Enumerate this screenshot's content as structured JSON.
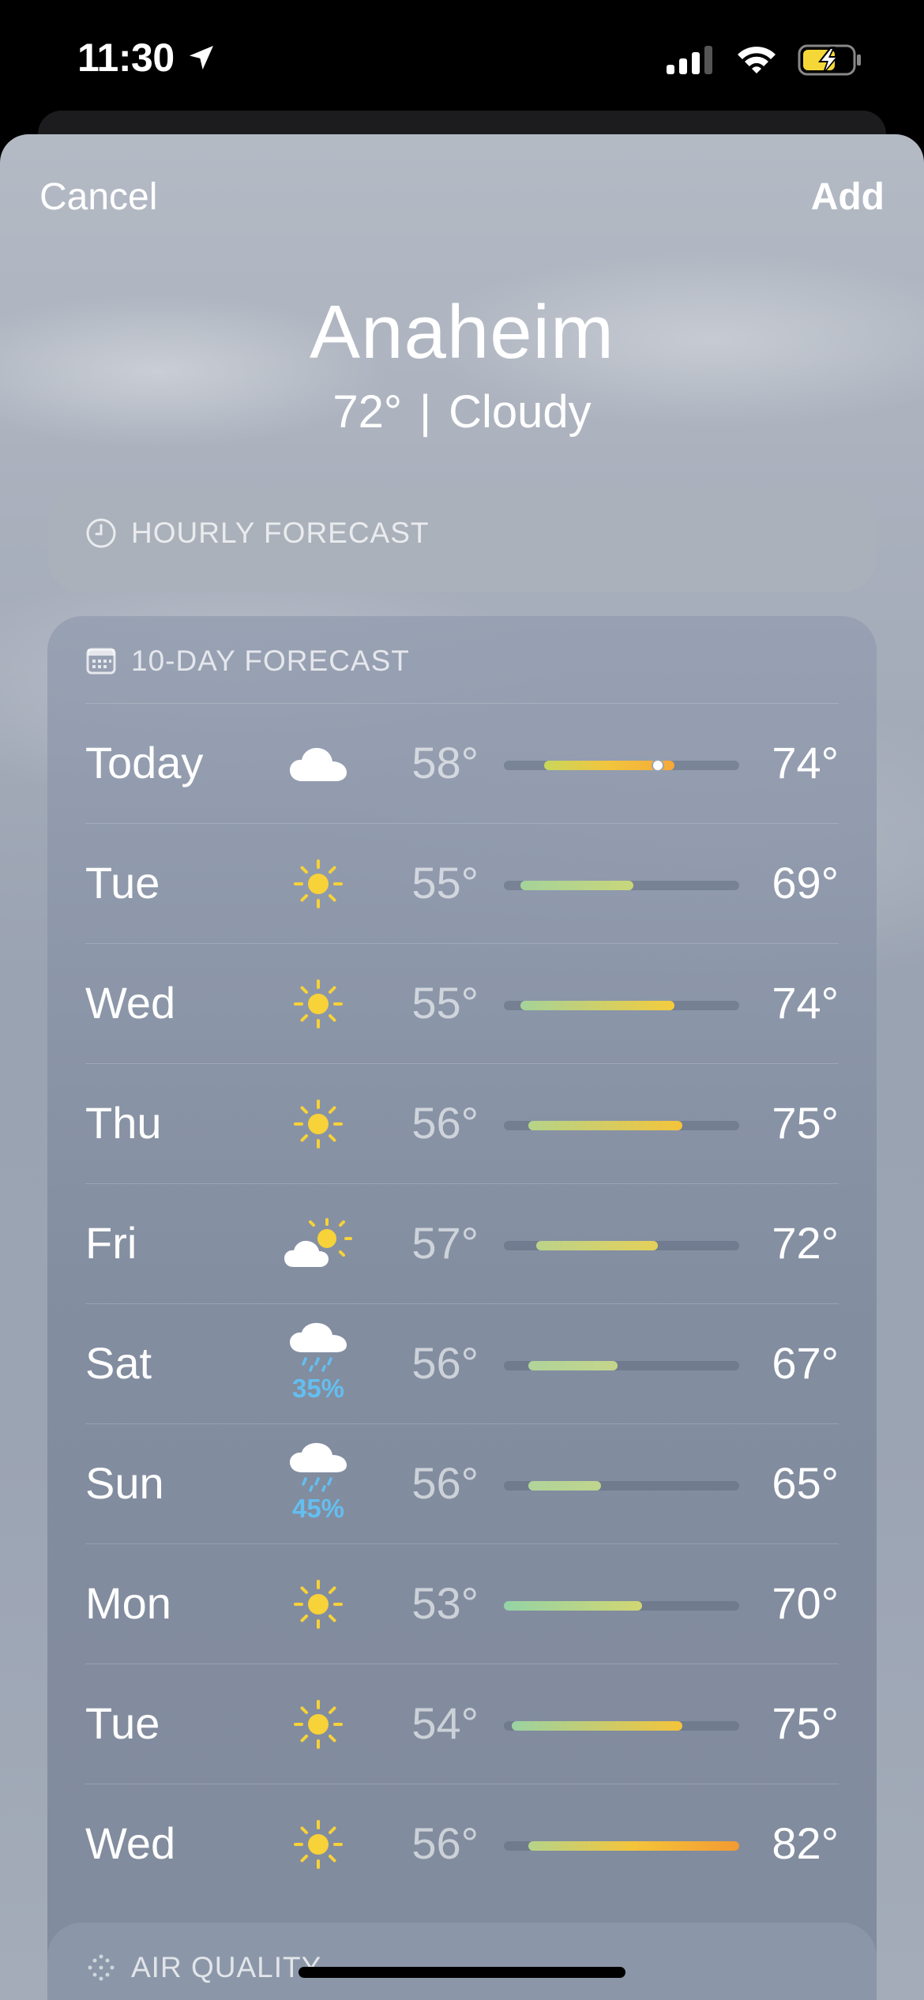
{
  "status_bar": {
    "time": "11:30"
  },
  "nav": {
    "cancel_label": "Cancel",
    "add_label": "Add"
  },
  "location": {
    "city": "Anaheim",
    "temperature": "72°",
    "separator": "|",
    "condition": "Cloudy"
  },
  "hourly": {
    "title": "HOURLY FORECAST"
  },
  "daily": {
    "title": "10-DAY FORECAST",
    "range_min": 53,
    "range_max": 82,
    "current_temp": 72,
    "days": [
      {
        "day": "Today",
        "icon": "cloud-icon",
        "precip": "",
        "low": "58°",
        "high": "74°",
        "low_val": 58,
        "high_val": 74,
        "colors": [
          "#c9d65a",
          "#f2c53d",
          "#f6a838"
        ],
        "current": true
      },
      {
        "day": "Tue",
        "icon": "sun-icon",
        "precip": "",
        "low": "55°",
        "high": "69°",
        "low_val": 55,
        "high_val": 69,
        "colors": [
          "#a5d39a",
          "#c9d67a"
        ]
      },
      {
        "day": "Wed",
        "icon": "sun-icon",
        "precip": "",
        "low": "55°",
        "high": "74°",
        "low_val": 55,
        "high_val": 74,
        "colors": [
          "#a5d39a",
          "#f4cc3c"
        ]
      },
      {
        "day": "Thu",
        "icon": "sun-icon",
        "precip": "",
        "low": "56°",
        "high": "75°",
        "low_val": 56,
        "high_val": 75,
        "colors": [
          "#b5d48a",
          "#f4c43a"
        ]
      },
      {
        "day": "Fri",
        "icon": "partly-sunny-icon",
        "precip": "",
        "low": "57°",
        "high": "72°",
        "low_val": 57,
        "high_val": 72,
        "colors": [
          "#bcd38a",
          "#e4d05a"
        ]
      },
      {
        "day": "Sat",
        "icon": "rain-icon",
        "precip": "35%",
        "low": "56°",
        "high": "67°",
        "low_val": 56,
        "high_val": 67,
        "colors": [
          "#b0d49a",
          "#c5d58a"
        ]
      },
      {
        "day": "Sun",
        "icon": "rain-icon",
        "precip": "45%",
        "low": "56°",
        "high": "65°",
        "low_val": 56,
        "high_val": 65,
        "colors": [
          "#b0d49a",
          "#c0d58e"
        ]
      },
      {
        "day": "Mon",
        "icon": "sun-icon",
        "precip": "",
        "low": "53°",
        "high": "70°",
        "low_val": 53,
        "high_val": 70,
        "colors": [
          "#94d3a6",
          "#d2d772"
        ]
      },
      {
        "day": "Tue",
        "icon": "sun-icon",
        "precip": "",
        "low": "54°",
        "high": "75°",
        "low_val": 54,
        "high_val": 75,
        "colors": [
          "#9bd3a2",
          "#f4c43a"
        ]
      },
      {
        "day": "Wed",
        "icon": "sun-icon",
        "precip": "",
        "low": "56°",
        "high": "82°",
        "low_val": 56,
        "high_val": 82,
        "colors": [
          "#b5d48a",
          "#f4c43a",
          "#f39a32"
        ]
      }
    ]
  },
  "air_quality": {
    "title": "AIR QUALITY"
  }
}
